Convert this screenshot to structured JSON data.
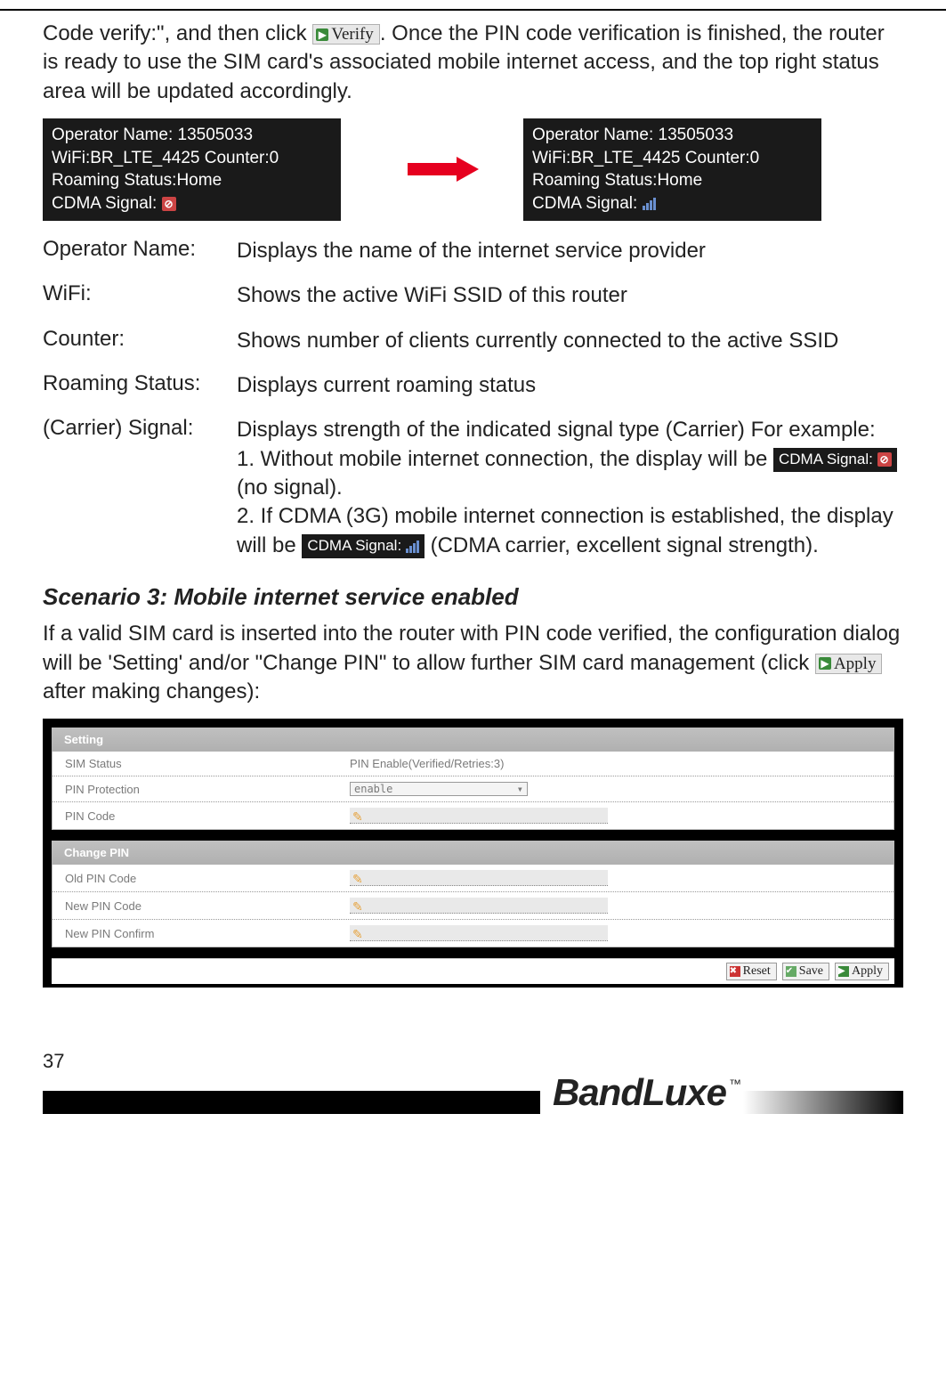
{
  "intro": {
    "part1": "Code verify:\", and then click ",
    "verify_btn": "Verify",
    "part2": ". Once the PIN code verification is finished, the router is ready to use the SIM card's associated mobile internet access, and the top right status area will be updated accordingly."
  },
  "status_before": {
    "operator": "Operator Name: 13505033",
    "wifi": "WiFi:BR_LTE_4425 Counter:0",
    "roaming": "Roaming Status:Home",
    "signal_label": "CDMA Signal:",
    "signal_state": "error"
  },
  "status_after": {
    "operator": "Operator Name: 13505033",
    "wifi": "WiFi:BR_LTE_4425 Counter:0",
    "roaming": "Roaming Status:Home",
    "signal_label": "CDMA Signal:",
    "signal_state": "full"
  },
  "defs": [
    {
      "term": "Operator Name:",
      "desc": "Displays the name of the internet service provider"
    },
    {
      "term": "WiFi:",
      "desc": "Shows the active WiFi SSID of this router"
    },
    {
      "term": "Counter:",
      "desc": "Shows number of clients currently connected to the active SSID"
    },
    {
      "term": "Roaming Status:",
      "desc": "Displays current roaming status"
    }
  ],
  "def_signal": {
    "term": "(Carrier) Signal:",
    "l1": "Displays strength of the indicated signal type (Carrier) For example:",
    "l2a": "1. Without mobile internet connection, the display will be  ",
    "sig_err_label": "CDMA Signal:",
    "l2b": "  (no signal).",
    "l3a": "2. If CDMA (3G) mobile internet connection is established, the display will be ",
    "sig_full_label": "CDMA Signal:",
    "l3b": "   (CDMA carrier, excellent signal strength)."
  },
  "scenario3": {
    "heading": "Scenario 3: Mobile internet service enabled",
    "p_a": "If a valid SIM card is inserted into the router with PIN code verified, the configuration dialog will be 'Setting' and/or \"Change PIN\" to allow further SIM card management (click ",
    "apply_btn": "Apply",
    "p_b": " after making changes):"
  },
  "cfg": {
    "panel1_title": "Setting",
    "sim_status_label": "SIM Status",
    "sim_status_value": "PIN Enable(Verified/Retries:3)",
    "pin_protection_label": "PIN Protection",
    "pin_protection_value": "enable",
    "pin_code_label": "PIN Code",
    "panel2_title": "Change PIN",
    "old_pin_label": "Old PIN Code",
    "new_pin_label": "New PIN Code",
    "new_pin_confirm_label": "New PIN Confirm",
    "btn_reset": "Reset",
    "btn_save": "Save",
    "btn_apply": "Apply"
  },
  "footer": {
    "page_num": "37",
    "brand": "BandLuxe",
    "tm": "™"
  }
}
